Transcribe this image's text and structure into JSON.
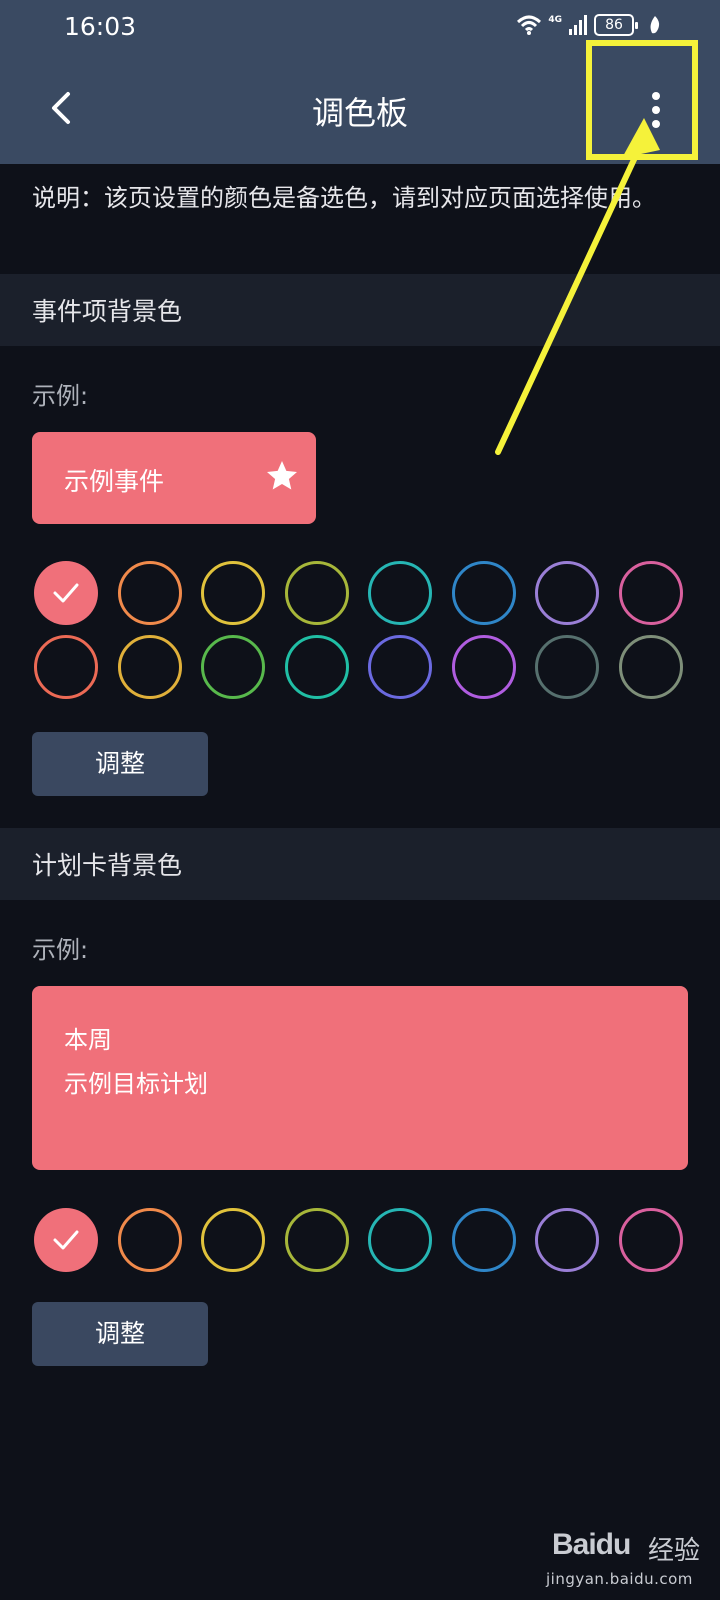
{
  "status_bar": {
    "time": "16:03",
    "network": "4G",
    "battery": "86"
  },
  "header": {
    "title": "调色板",
    "back_icon": "chevron-left-icon",
    "more_icon": "more-vertical-icon"
  },
  "description": "说明：该页设置的颜色是备选色，请到对应页面选择使用。",
  "event_section": {
    "title": "事件项背景色",
    "example_label": "示例:",
    "sample_text": "示例事件",
    "sample_color": "#f0707a",
    "palette": [
      "#f0707a",
      "#f08a4b",
      "#e0c23c",
      "#a7b73a",
      "#26b6b4",
      "#2f86c8",
      "#9a7fd6",
      "#d9609e",
      "#ec6a55",
      "#e0b03a",
      "#58b94c",
      "#20bfa5",
      "#6b6ae0",
      "#b05de0",
      "#56706e",
      "#7e8f79"
    ],
    "selected_index": 0,
    "adjust_label": "调整"
  },
  "plan_section": {
    "title": "计划卡背景色",
    "example_label": "示例:",
    "sample_line1": "本周",
    "sample_line2": "示例目标计划",
    "sample_color": "#f0707a",
    "palette": [
      "#f0707a",
      "#f08a4b",
      "#e0c23c",
      "#a7b73a",
      "#26b6b4",
      "#2f86c8",
      "#9a7fd6",
      "#d9609e"
    ],
    "selected_index": 0,
    "adjust_label": "调整"
  },
  "watermark": {
    "brand": "Baidu",
    "sub": "经验",
    "url": "jingyan.baidu.com"
  },
  "annotation_color": "#f5f23a"
}
